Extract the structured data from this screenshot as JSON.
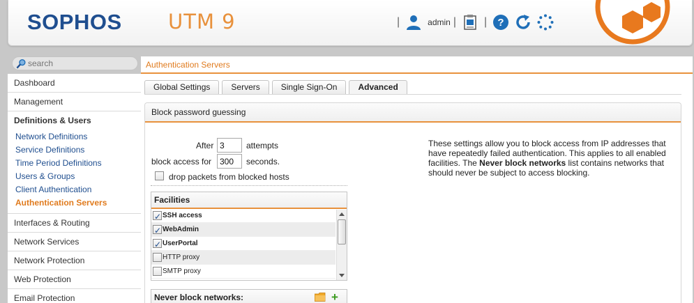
{
  "header": {
    "brand": "SOPHOS",
    "product": "UTM 9",
    "user": "admin",
    "colors": {
      "brand": "#1f4e8f",
      "accent": "#e8913c"
    },
    "icons": [
      "user-icon",
      "clipboard-icon",
      "help-icon",
      "reload-icon",
      "activity-icon"
    ]
  },
  "search": {
    "placeholder": "search"
  },
  "nav": {
    "items": [
      {
        "label": "Dashboard"
      },
      {
        "label": "Management"
      },
      {
        "label": "Definitions & Users"
      },
      {
        "label": "Interfaces & Routing"
      },
      {
        "label": "Network Services"
      },
      {
        "label": "Network Protection"
      },
      {
        "label": "Web Protection"
      },
      {
        "label": "Email Protection"
      }
    ],
    "subitems": [
      {
        "label": "Network Definitions"
      },
      {
        "label": "Service Definitions"
      },
      {
        "label": "Time Period Definitions"
      },
      {
        "label": "Users & Groups"
      },
      {
        "label": "Client Authentication"
      },
      {
        "label": "Authentication Servers"
      }
    ]
  },
  "main": {
    "breadcrumb": "Authentication Servers",
    "tabs": [
      {
        "label": "Global Settings"
      },
      {
        "label": "Servers"
      },
      {
        "label": "Single Sign-On"
      },
      {
        "label": "Advanced"
      }
    ],
    "section": {
      "title": "Block password guessing",
      "after_label": "After",
      "attempts_value": "3",
      "attempts_label": "attempts",
      "block_label": "block access for",
      "seconds_value": "300",
      "seconds_label": "seconds.",
      "drop_label": "drop packets from blocked hosts",
      "facilities": {
        "title": "Facilities",
        "items": [
          {
            "label": "SSH access",
            "checked": true
          },
          {
            "label": "WebAdmin",
            "checked": true
          },
          {
            "label": "UserPortal",
            "checked": true
          },
          {
            "label": "HTTP proxy",
            "checked": false
          },
          {
            "label": "SMTP proxy",
            "checked": false
          }
        ]
      },
      "never_block": {
        "title": "Never block networks:"
      },
      "help": {
        "part1": "These settings allow you to block access from IP addresses that have repeatedly failed authentication. This applies to all enabled facilities. The ",
        "bold": "Never block networks",
        "part2": " list contains networks that should never be subject to access blocking."
      }
    }
  }
}
